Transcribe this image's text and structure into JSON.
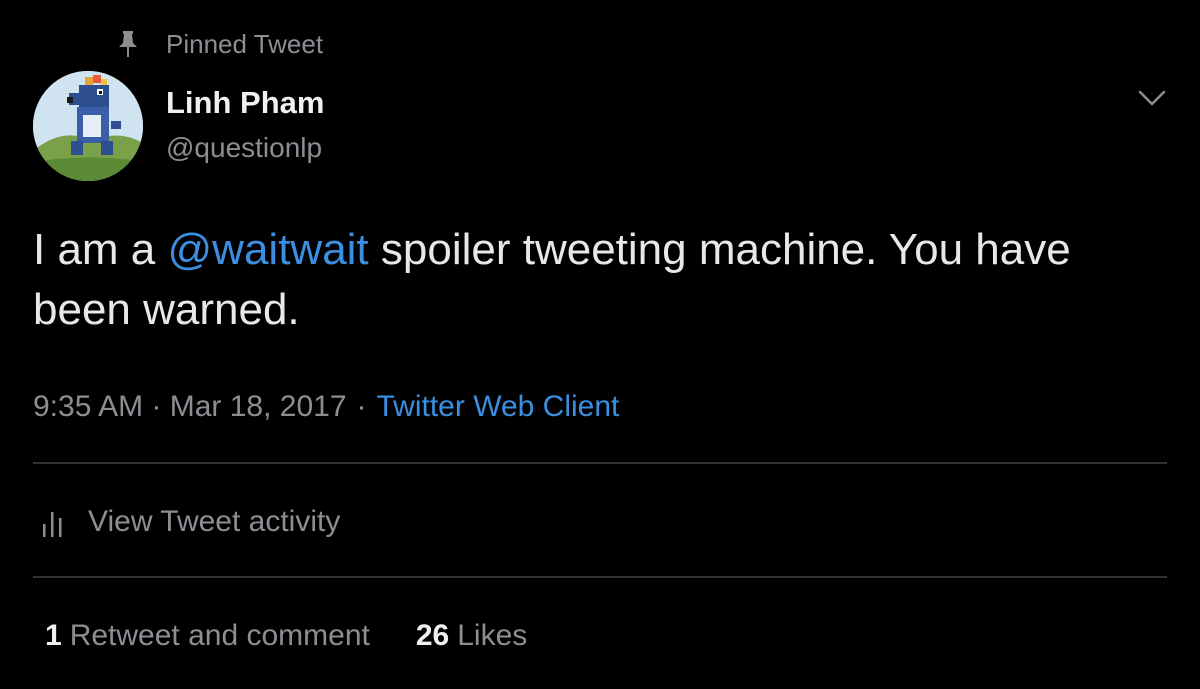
{
  "pinned": {
    "label": "Pinned Tweet",
    "icon": "pin-icon"
  },
  "user": {
    "name": "Linh Pham",
    "handle": "@questionlp",
    "avatar_icon": "avatar-pixel-creature"
  },
  "tweet": {
    "text_before": "I am a ",
    "mention": "@waitwait",
    "text_after": " spoiler tweeting machine. You have been warned."
  },
  "meta": {
    "time_date": "9:35 AM · Mar 18, 2017",
    "separator": "·",
    "source": "Twitter Web Client"
  },
  "activity": {
    "label": "View Tweet activity",
    "icon": "bar-chart-icon"
  },
  "stats": {
    "retweets_count": "1",
    "retweets_label": "Retweet and comment",
    "likes_count": "26",
    "likes_label": "Likes"
  },
  "colors": {
    "background": "#000000",
    "text_primary": "#e8e8e8",
    "text_secondary": "#8b8f94",
    "link": "#3a8fe0",
    "divider": "#2f3336"
  }
}
